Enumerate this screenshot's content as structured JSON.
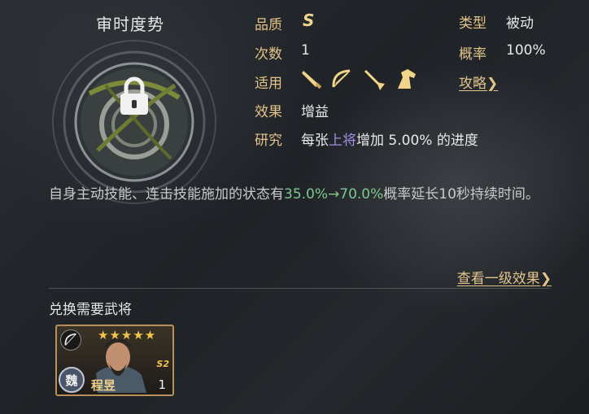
{
  "skill": {
    "name": "审时度势"
  },
  "attributes": {
    "quality_label": "品质",
    "quality_value": "S",
    "type_label": "类型",
    "type_value": "被动",
    "count_label": "次数",
    "count_value": "1",
    "rate_label": "概率",
    "rate_value": "100%",
    "applicable_label": "适用",
    "applicable_icons": [
      "sword-icon",
      "bow-icon",
      "spear-icon",
      "horse-icon"
    ],
    "strategy_link": "攻略",
    "effect_label": "效果",
    "effect_value": "增益",
    "research_label": "研究",
    "research_pre": "每张",
    "research_highlight": "上将",
    "research_mid": "增加",
    "research_amount": "5.00%",
    "research_post": "的进度"
  },
  "description": {
    "pre": "自身主动技能、连击技能施加的状态有",
    "highlight": "35.0%→70.0%",
    "post": "概率延长10秒持续时间。"
  },
  "view_level_link": "查看一级效果",
  "exchange": {
    "title": "兑换需要武将",
    "general": {
      "name": "程昱",
      "faction": "魏",
      "stars": "★★★★★",
      "season": "S2",
      "level": "1"
    }
  },
  "colors": {
    "gold": "#e2c48a",
    "green": "#7dc98e",
    "purple": "#a48ce6"
  }
}
